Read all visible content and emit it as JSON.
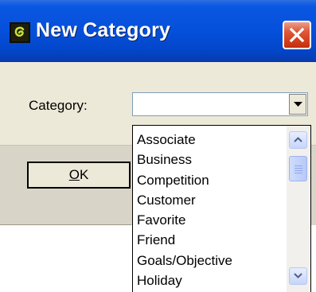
{
  "window": {
    "title": "New Category",
    "icon": "app-icon",
    "close_icon": "close-icon"
  },
  "form": {
    "category_label": "Category:",
    "category_value": ""
  },
  "buttons": {
    "ok_mnemonic": "O",
    "ok_rest": "K"
  },
  "dropdown": {
    "items": [
      "Associate",
      "Business",
      "Competition",
      "Customer",
      "Favorite",
      "Friend",
      "Goals/Objective",
      "Holiday"
    ]
  },
  "colors": {
    "titlebar": "#0550db",
    "close_button": "#d4401e",
    "dialog_background": "#ece9d8"
  }
}
